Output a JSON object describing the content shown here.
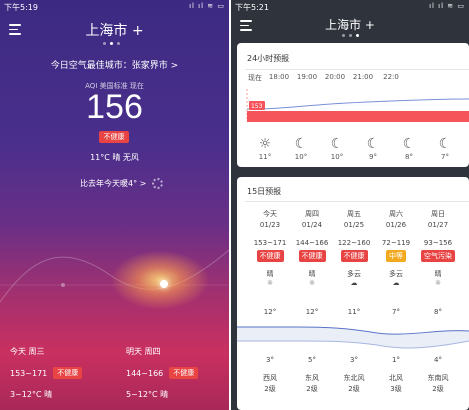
{
  "left": {
    "status": {
      "time": "下午5:19",
      "icons": "ıl ıl ≋ ▭"
    },
    "city": "上海市 +",
    "best_city": "今日空气最佳城市：张家界市 >",
    "aqi_source": "AQI 美国标准 现在",
    "aqi": "156",
    "aqi_level": "不健康",
    "condition": "11°C  晴  无风",
    "compare": "比去年今天暖4°  >",
    "today": {
      "label": "今天  周三",
      "aqi": "153~171",
      "level": "不健康",
      "temp": "3~12°C  晴"
    },
    "tomorrow": {
      "label": "明天  周四",
      "aqi": "144~166",
      "level": "不健康",
      "temp": "5~12°C  晴"
    }
  },
  "right": {
    "status": {
      "time": "下午5:21",
      "icons": "ıl ıl ≋ ▭"
    },
    "city": "上海市 +",
    "hourly_title": "24小时预报",
    "hourly_now_aqi": "153",
    "hours": [
      "现在",
      "18:00",
      "19:00",
      "20:00",
      "21:00",
      "22:0"
    ],
    "hour_icons": [
      "☼",
      "☾",
      "☾",
      "☾",
      "☾",
      "☾"
    ],
    "hour_temps": [
      "11°",
      "10°",
      "10°",
      "9°",
      "8°",
      "7°"
    ],
    "daily_title": "15日预报",
    "days": [
      {
        "name": "今天",
        "date": "01/23",
        "aqi": "153~171",
        "level": "不健康",
        "level_color": "red",
        "weather": "晴",
        "icon": "☼",
        "high": "12°",
        "low": "3°",
        "wind": "西风",
        "wind_level": "2级"
      },
      {
        "name": "周四",
        "date": "01/24",
        "aqi": "144~166",
        "level": "不健康",
        "level_color": "red",
        "weather": "晴",
        "icon": "☼",
        "high": "12°",
        "low": "5°",
        "wind": "东风",
        "wind_level": "2级"
      },
      {
        "name": "周五",
        "date": "01/25",
        "aqi": "122~160",
        "level": "不健康",
        "level_color": "red",
        "weather": "多云",
        "icon": "☁",
        "high": "11°",
        "low": "3°",
        "wind": "东北风",
        "wind_level": "2级"
      },
      {
        "name": "周六",
        "date": "01/26",
        "aqi": "72~119",
        "level": "中等",
        "level_color": "yellow",
        "weather": "多云",
        "icon": "☁",
        "high": "7°",
        "low": "1°",
        "wind": "北风",
        "wind_level": "3级"
      },
      {
        "name": "周日",
        "date": "01/27",
        "aqi": "93~156",
        "level": "空气污染",
        "level_color": "red",
        "weather": "晴",
        "icon": "☼",
        "high": "8°",
        "low": "4°",
        "wind": "东南风",
        "wind_level": "2级"
      }
    ]
  }
}
